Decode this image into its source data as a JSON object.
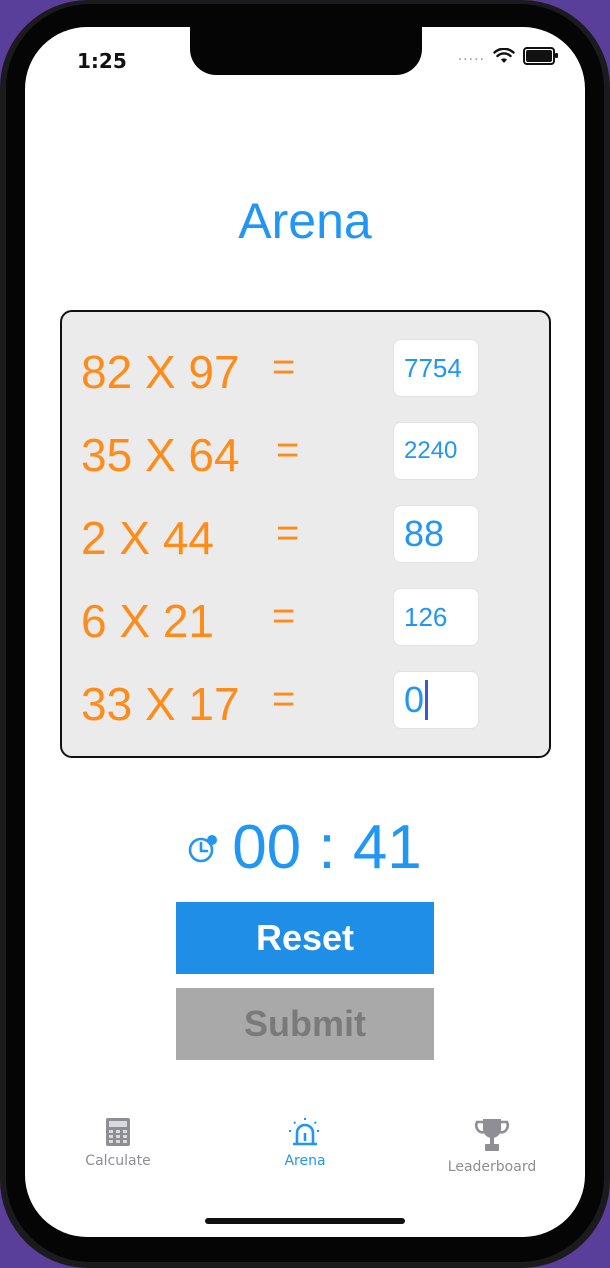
{
  "status": {
    "time": "1:25",
    "dots": "....."
  },
  "screen": {
    "title": "Arena"
  },
  "quiz": {
    "rows": [
      {
        "expression": "82 X 97",
        "equals": "=",
        "answer": "7754"
      },
      {
        "expression": "35 X 64",
        "equals": "=",
        "answer": "2240"
      },
      {
        "expression": "2 X 44",
        "equals": "=",
        "answer": "88"
      },
      {
        "expression": "6 X 21",
        "equals": "=",
        "answer": "126"
      },
      {
        "expression": "33 X 17",
        "equals": "=",
        "answer": "0"
      }
    ]
  },
  "timer": {
    "display": "00 : 41",
    "icon": "stopwatch-icon"
  },
  "buttons": {
    "reset": "Reset",
    "submit": "Submit"
  },
  "tabs": [
    {
      "label": "Calculate",
      "icon": "calculator-icon",
      "active": false
    },
    {
      "label": "Arena",
      "icon": "siren-icon",
      "active": true
    },
    {
      "label": "Leaderboard",
      "icon": "trophy-icon",
      "active": false
    }
  ],
  "colors": {
    "accent": "#2196f3",
    "orange": "#ff8c1a",
    "inactive_tab": "#8e8e93",
    "submit_disabled": "#a9a9a9"
  }
}
